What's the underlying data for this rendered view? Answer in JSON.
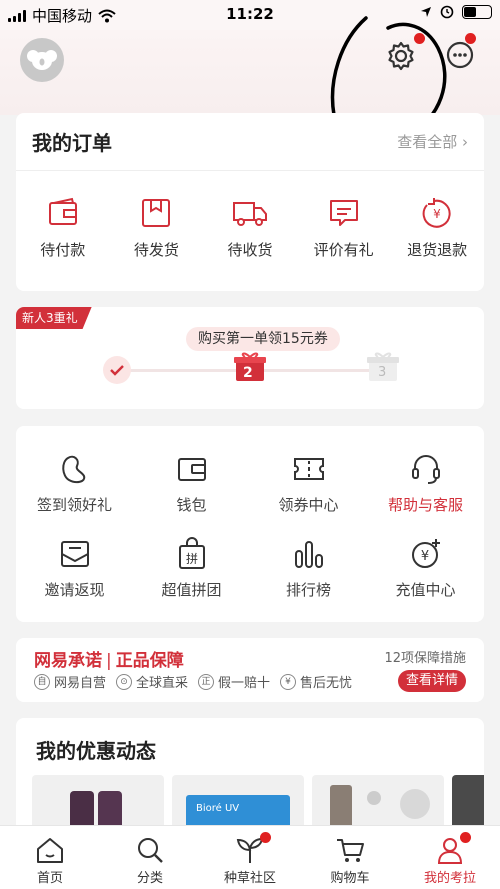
{
  "status": {
    "carrier": "中国移动",
    "time": "11:22"
  },
  "orders": {
    "title": "我的订单",
    "view_all": "查看全部",
    "items": [
      {
        "label": "待付款",
        "icon": "wallet-icon"
      },
      {
        "label": "待发货",
        "icon": "package-icon"
      },
      {
        "label": "待收货",
        "icon": "truck-icon"
      },
      {
        "label": "评价有礼",
        "icon": "comment-icon"
      },
      {
        "label": "退货退款",
        "icon": "refund-icon"
      }
    ]
  },
  "newuser": {
    "ribbon": "新人3重礼",
    "coupon": "购买第一单领15元券",
    "steps": [
      "2",
      "3"
    ]
  },
  "services": {
    "items": [
      {
        "label": "签到领好礼",
        "icon": "bean-icon"
      },
      {
        "label": "钱包",
        "icon": "wallet-icon"
      },
      {
        "label": "领券中心",
        "icon": "ticket-icon"
      },
      {
        "label": "帮助与客服",
        "icon": "headset-icon",
        "highlight": true
      },
      {
        "label": "邀请返现",
        "icon": "envelope-icon"
      },
      {
        "label": "超值拼团",
        "icon": "group-bag-icon"
      },
      {
        "label": "排行榜",
        "icon": "ranking-icon"
      },
      {
        "label": "充值中心",
        "icon": "recharge-icon"
      }
    ],
    "group_glyph": "拼",
    "yen": "¥"
  },
  "promise": {
    "title_a": "网易承诺",
    "title_b": "正品保障",
    "count": "12项保障措施",
    "items": [
      {
        "label": "网易自营",
        "glyph": "自"
      },
      {
        "label": "全球直采",
        "glyph": "⊙"
      },
      {
        "label": "假一赔十",
        "glyph": "正"
      },
      {
        "label": "售后无忧",
        "glyph": "¥"
      }
    ],
    "button": "查看详情"
  },
  "deals": {
    "title": "我的优惠动态",
    "thumb_text": "Bioré UV"
  },
  "tabs": [
    {
      "label": "首页",
      "icon": "home-icon"
    },
    {
      "label": "分类",
      "icon": "search-icon"
    },
    {
      "label": "种草社区",
      "icon": "sprout-icon"
    },
    {
      "label": "购物车",
      "icon": "cart-icon"
    },
    {
      "label": "我的考拉",
      "icon": "profile-icon",
      "active": true
    }
  ],
  "colors": {
    "accent": "#d2303a",
    "badge": "#e02020"
  }
}
